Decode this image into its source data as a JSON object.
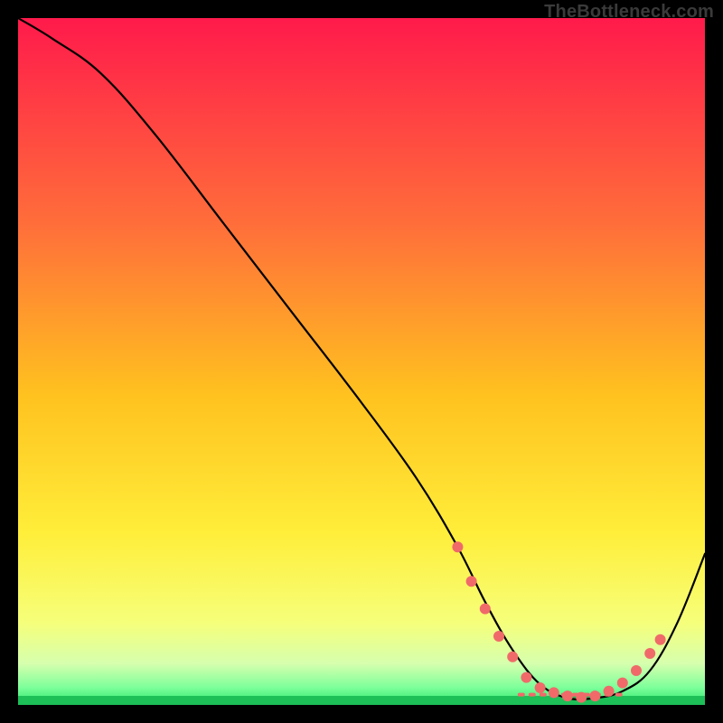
{
  "watermark": "TheBottleneck.com",
  "chart_data": {
    "type": "line",
    "title": "",
    "xlabel": "",
    "ylabel": "",
    "xlim": [
      0,
      100
    ],
    "ylim": [
      0,
      100
    ],
    "grid": false,
    "legend": false,
    "background_gradient": {
      "stops": [
        {
          "offset": 0.0,
          "color": "#ff1a4b"
        },
        {
          "offset": 0.3,
          "color": "#ff6e3a"
        },
        {
          "offset": 0.55,
          "color": "#ffc21f"
        },
        {
          "offset": 0.75,
          "color": "#ffee3a"
        },
        {
          "offset": 0.88,
          "color": "#f6ff7a"
        },
        {
          "offset": 0.94,
          "color": "#d6ffae"
        },
        {
          "offset": 0.975,
          "color": "#7cff9a"
        },
        {
          "offset": 1.0,
          "color": "#28e56a"
        }
      ]
    },
    "series": [
      {
        "name": "bottleneck-curve",
        "color": "#000000",
        "x": [
          0,
          5,
          12,
          20,
          30,
          40,
          50,
          58,
          64,
          68,
          72,
          76,
          80,
          84,
          88,
          92,
          96,
          100
        ],
        "y": [
          100,
          97,
          92,
          83,
          70,
          57,
          44,
          33,
          23,
          15,
          8,
          3,
          1,
          1,
          2,
          5,
          12,
          22
        ]
      }
    ],
    "markers": {
      "name": "highlight-dots",
      "color": "#f06a6a",
      "radius": 6,
      "points": [
        {
          "x": 64,
          "y": 23
        },
        {
          "x": 66,
          "y": 18
        },
        {
          "x": 68,
          "y": 14
        },
        {
          "x": 70,
          "y": 10
        },
        {
          "x": 72,
          "y": 7
        },
        {
          "x": 74,
          "y": 4
        },
        {
          "x": 76,
          "y": 2.5
        },
        {
          "x": 78,
          "y": 1.8
        },
        {
          "x": 80,
          "y": 1.3
        },
        {
          "x": 82,
          "y": 1.1
        },
        {
          "x": 84,
          "y": 1.3
        },
        {
          "x": 86,
          "y": 2.0
        },
        {
          "x": 88,
          "y": 3.2
        },
        {
          "x": 90,
          "y": 5.0
        },
        {
          "x": 92,
          "y": 7.5
        },
        {
          "x": 93.5,
          "y": 9.5
        }
      ],
      "dashed_span": {
        "x_start": 73,
        "x_end": 88,
        "y": 1.5
      }
    }
  }
}
